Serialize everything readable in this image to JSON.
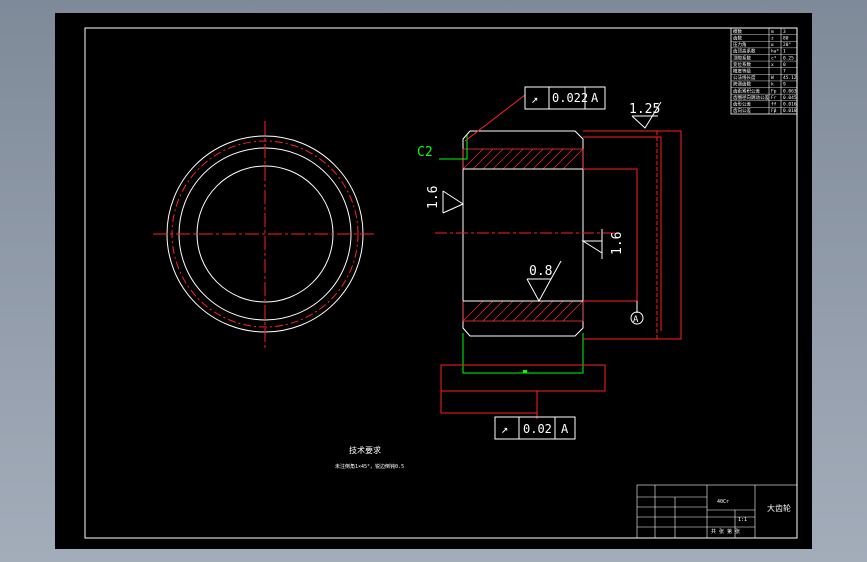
{
  "drawing": {
    "colors": {
      "background": "#000000",
      "outline": "#ffffff",
      "centerline": "#ff2020",
      "dimension": "#ff2020",
      "annotation_green": "#00ff00",
      "hatch": "#ff3030"
    },
    "runout_top": {
      "symbol": "↗",
      "value": "0.022",
      "datum": "A"
    },
    "runout_bottom": {
      "symbol": "↗",
      "value": "0.02",
      "datum": "A"
    },
    "roughness": {
      "top": "1.25",
      "left": "1.6",
      "right": "1.6",
      "bore": "0.8"
    },
    "chamfer": "C2",
    "datum_label": "A",
    "tech_requirements": {
      "title": "技术要求",
      "line1": "未注倒角1×45°，锐边倒钝0.5"
    },
    "title_block": {
      "part_name": "大齿轮",
      "material": "40Cr",
      "scale": "1:1",
      "sheet": "共 张 第 张"
    },
    "param_table": {
      "rows": [
        [
          "模数",
          "m",
          "3"
        ],
        [
          "齿数",
          "z",
          "80"
        ],
        [
          "压力角",
          "α",
          "20°"
        ],
        [
          "齿顶高系数",
          "ha*",
          "1"
        ],
        [
          "顶隙系数",
          "c*",
          "0.25"
        ],
        [
          "变位系数",
          "x",
          "0"
        ],
        [
          "精度等级",
          "",
          "7"
        ],
        [
          "公法线长度",
          "W",
          "45.12"
        ],
        [
          "跨测齿数",
          "k",
          "9"
        ],
        [
          "齿距累积公差",
          "Fp",
          "0.063"
        ],
        [
          "齿圈径向跳动公差",
          "Fr",
          "0.045"
        ],
        [
          "齿形公差",
          "ff",
          "0.016"
        ],
        [
          "齿向公差",
          "Fβ",
          "0.018"
        ]
      ]
    }
  }
}
